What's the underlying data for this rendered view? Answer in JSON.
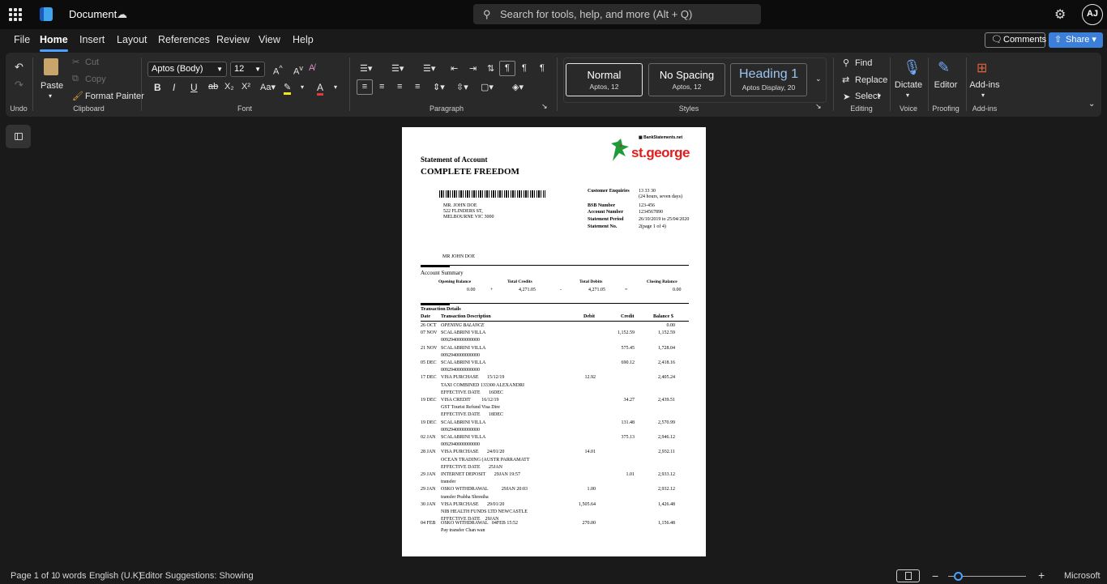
{
  "titlebar": {
    "doc_title": "Document",
    "search_placeholder": "Search for tools, help, and more (Alt + Q)",
    "avatar_initials": "AJ"
  },
  "menu": [
    "File",
    "Home",
    "Insert",
    "Layout",
    "References",
    "Review",
    "View",
    "Help"
  ],
  "actions": {
    "comments": "Comments",
    "share": "Share"
  },
  "ribbon": {
    "undo_group": "Undo",
    "clipboard": {
      "paste": "Paste",
      "cut": "Cut",
      "copy": "Copy",
      "format_painter": "Format Painter",
      "label": "Clipboard"
    },
    "font": {
      "family": "Aptos (Body)",
      "size": "12",
      "label": "Font"
    },
    "paragraph": {
      "label": "Paragraph"
    },
    "styles": {
      "label": "Styles",
      "items": [
        {
          "name": "Normal",
          "sub": "Aptos, 12"
        },
        {
          "name": "No Spacing",
          "sub": "Aptos, 12"
        },
        {
          "name": "Heading 1",
          "sub": "Aptos Display, 20"
        }
      ]
    },
    "editing": {
      "find": "Find",
      "replace": "Replace",
      "select": "Select",
      "label": "Editing"
    },
    "voice": {
      "dictate": "Dictate",
      "label": "Voice"
    },
    "proofing": {
      "editor": "Editor",
      "label": "Proofing"
    },
    "addins": {
      "addins": "Add-ins",
      "label": "Add-ins"
    }
  },
  "document": {
    "source_logo": "BankStatements.net",
    "bank_logo": "st.george",
    "title1": "Statement of Account",
    "title2": "COMPLETE FREEDOM",
    "address": [
      "MR. JOHN DOE",
      "522 FLINDERS ST,",
      "MELBOURNE VIC 3000"
    ],
    "info": [
      {
        "k": "Customer Enquiries",
        "v": "13 33 30"
      },
      {
        "k": "",
        "v": "(24 hours, seven days)"
      },
      {
        "k": "BSB Number",
        "v": "123-456"
      },
      {
        "k": "Account Number",
        "v": "1234567890"
      },
      {
        "k": "Statement Period",
        "v": "26/10/2019 to 25/04/2020"
      },
      {
        "k": "Statement No.",
        "v": "2(page 1 of 4)"
      }
    ],
    "holder": "MR JOHN DOE",
    "summary": {
      "title": "Account Summary",
      "headers": [
        "Opening Balance",
        "Total Credits",
        "Total Debits",
        "Closing Balance"
      ],
      "values": [
        "0.00",
        "+",
        "4,271.05",
        "-",
        "4,271.05",
        "=",
        "0.00"
      ]
    },
    "txn": {
      "title": "Transaction Details",
      "headers": [
        "Date",
        "Transaction Description",
        "Debit",
        "Credit",
        "Balance $"
      ],
      "rows": [
        {
          "d": "26 OCT",
          "l": [
            "OPENING BALANCE"
          ],
          "dr": "",
          "cr": "",
          "bal": "0.00",
          "italic": true
        },
        {
          "d": "07 NOV",
          "l": [
            "SCALABRINI VILLA",
            "0092940000000000"
          ],
          "dr": "",
          "cr": "1,152.59",
          "bal": "1,152.59"
        },
        {
          "d": "21 NOV",
          "l": [
            "SCALABRINI VILLA",
            "0092940000000000"
          ],
          "dr": "",
          "cr": "575.45",
          "bal": "1,728.04"
        },
        {
          "d": "05 DEC",
          "l": [
            "SCALABRINI VILLA",
            "0092940000000000"
          ],
          "dr": "",
          "cr": "690.12",
          "bal": "2,418.16"
        },
        {
          "d": "17 DEC",
          "l": [
            "VISA PURCHASE       15/12/19",
            "TAXI COMBINED 133300 ALEXANDRI",
            "EFFECTIVE DATE       16DEC"
          ],
          "dr": "12.92",
          "cr": "",
          "bal": "2,405.24"
        },
        {
          "d": "19 DEC",
          "l": [
            "VISA CREDIT         16/12/19",
            "GST Tourist Refund Visa Dire",
            "EFFECTIVE DATE       18DEC"
          ],
          "dr": "",
          "cr": "34.27",
          "bal": "2,439.51"
        },
        {
          "d": "19 DEC",
          "l": [
            "SCALABRINI VILLA",
            "0092940000000000"
          ],
          "dr": "",
          "cr": "131.48",
          "bal": "2,570.99"
        },
        {
          "d": "02 JAN",
          "l": [
            "SCALABRINI VILLA",
            "0092940000000000"
          ],
          "dr": "",
          "cr": "375.13",
          "bal": "2,946.12"
        },
        {
          "d": "28 JAN",
          "l": [
            "VISA PURCHASE       24/01/20",
            "OCEAN TRADING (AUSTR PARRAMATT",
            "EFFECTIVE DATE       25JAN"
          ],
          "dr": "14.01",
          "cr": "",
          "bal": "2,932.11"
        },
        {
          "d": "29 JAN",
          "l": [
            "INTERNET DEPOSIT       29JAN 19:57",
            "transfer"
          ],
          "dr": "",
          "cr": "1.01",
          "bal": "2,933.12"
        },
        {
          "d": "29 JAN",
          "l": [
            "OSKO WITHDRAWAL           29JAN 20:03",
            "transfer Prabha Shrestha"
          ],
          "dr": "1.00",
          "cr": "",
          "bal": "2,932.12"
        },
        {
          "d": "30 JAN",
          "l": [
            "VISA PURCHASE       29/01/20",
            "NIB HEALTH FUNDS LTD NEWCASTLE",
            "EFFECTIVE DATE    29JAN"
          ],
          "dr": "1,505.64",
          "cr": "",
          "bal": "1,426.48"
        },
        {
          "d": "04 FEB",
          "l": [
            "OSKO WITHDRAWAL   04FEB 15:52",
            "Pay transfer Chan wan"
          ],
          "dr": "270.00",
          "cr": "",
          "bal": "1,156.48"
        }
      ]
    }
  },
  "status": {
    "page": "Page 1 of 1",
    "words": "0 words",
    "language": "English (U.K)",
    "editor": "Editor Suggestions: Showing",
    "zoom_minus": "−",
    "zoom_plus": "+",
    "brand": "Microsoft"
  }
}
